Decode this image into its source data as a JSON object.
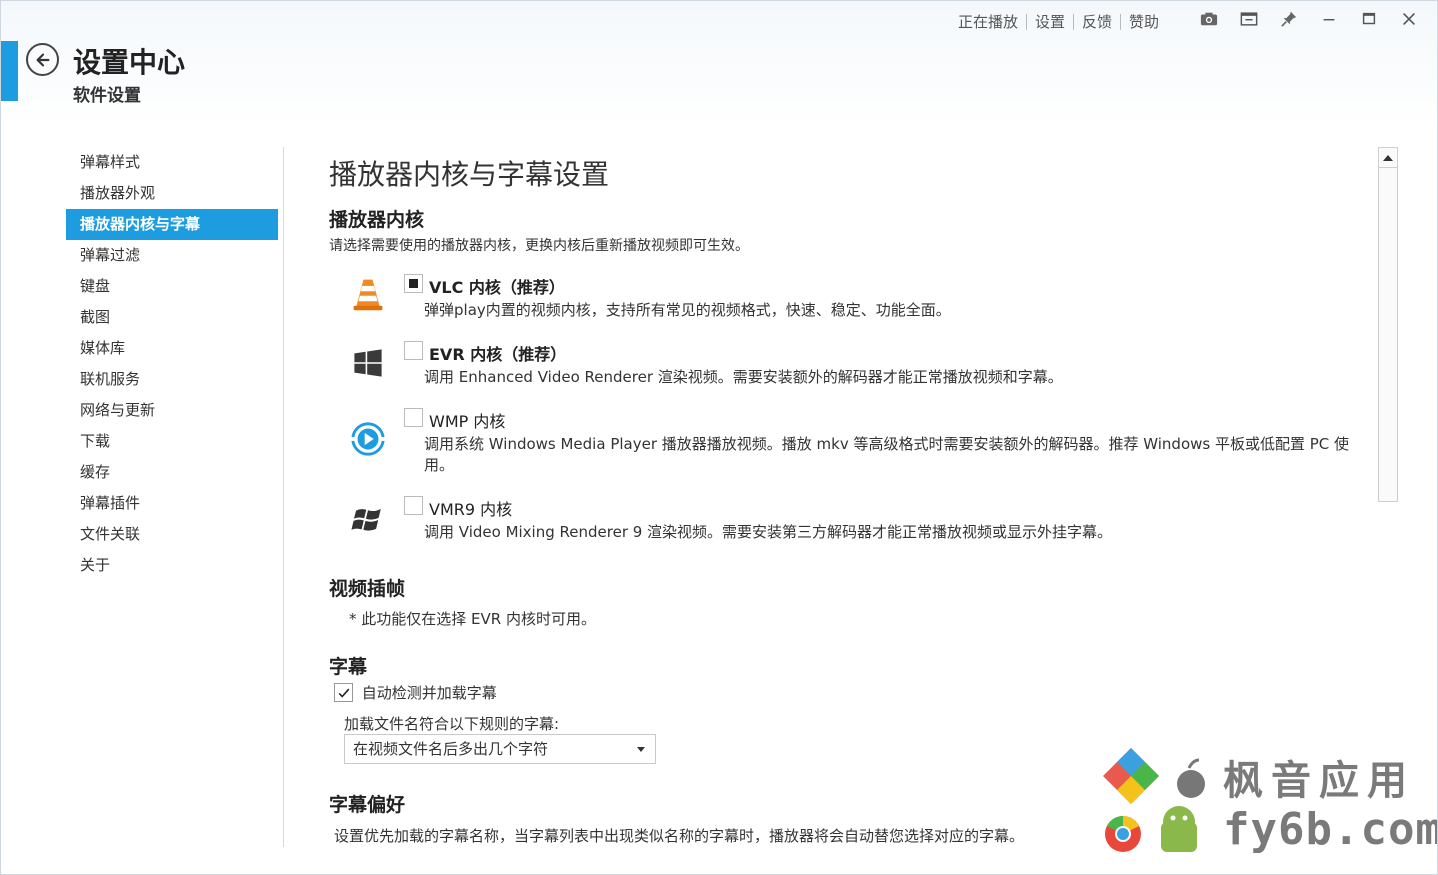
{
  "header": {
    "title": "设置中心",
    "subtitle": "软件设置",
    "links": [
      "正在播放",
      "设置",
      "反馈",
      "赞助"
    ]
  },
  "colors": {
    "accent": "#1e9ce0"
  },
  "window_controls": [
    "camera-icon",
    "miniplayer-icon",
    "pin-icon",
    "minimize-icon",
    "maximize-icon",
    "close-icon"
  ],
  "sidebar": {
    "items": [
      {
        "label": "弹幕样式"
      },
      {
        "label": "播放器外观"
      },
      {
        "label": "播放器内核与字幕",
        "active": true
      },
      {
        "label": "弹幕过滤"
      },
      {
        "label": "键盘"
      },
      {
        "label": "截图"
      },
      {
        "label": "媒体库"
      },
      {
        "label": "联机服务"
      },
      {
        "label": "网络与更新"
      },
      {
        "label": "下载"
      },
      {
        "label": "缓存"
      },
      {
        "label": "弹幕插件"
      },
      {
        "label": "文件关联"
      },
      {
        "label": "关于"
      }
    ]
  },
  "main": {
    "page_title": "播放器内核与字幕设置",
    "engine_section": {
      "title": "播放器内核",
      "desc": "请选择需要使用的播放器内核，更换内核后重新播放视频即可生效。",
      "engines": [
        {
          "name": "VLC 内核（推荐）",
          "desc": "弹弹play内置的视频内核，支持所有常见的视频格式，快速、稳定、功能全面。",
          "selected": true,
          "icon": "vlc-icon"
        },
        {
          "name": "EVR 内核（推荐）",
          "desc": "调用 Enhanced Video Renderer 渲染视频。需要安装额外的解码器才能正常播放视频和字幕。",
          "selected": false,
          "icon": "windows-icon"
        },
        {
          "name": "WMP 内核",
          "desc": "调用系统 Windows Media Player 播放器播放视频。播放 mkv 等高级格式时需要安装额外的解码器。推荐 Windows 平板或低配置 PC 使用。",
          "selected": false,
          "icon": "wmp-icon"
        },
        {
          "name": "VMR9 内核",
          "desc": "调用 Video Mixing Renderer 9 渲染视频。需要安装第三方解码器才能正常播放视频或显示外挂字幕。",
          "selected": false,
          "icon": "windows-flag-icon"
        }
      ]
    },
    "interp_section": {
      "title": "视频插帧",
      "note": "* 此功能仅在选择 EVR 内核时可用。"
    },
    "subtitle_section": {
      "title": "字幕",
      "auto_load_label": "自动检测并加载字幕",
      "auto_load_checked": true,
      "rule_label": "加载文件名符合以下规则的字幕:",
      "rule_value": "在视频文件名后多出几个字符"
    },
    "pref_section": {
      "title": "字幕偏好",
      "desc": "设置优先加载的字幕名称，当字幕列表中出现类似名称的字幕时，播放器将会自动替您选择对应的字幕。"
    }
  },
  "watermark": {
    "line1": "枫音应用",
    "line2": "fy6b.com"
  }
}
